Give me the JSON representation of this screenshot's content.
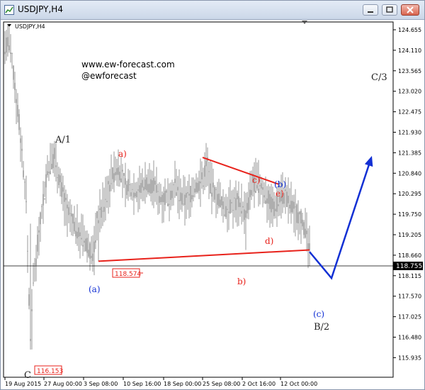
{
  "window": {
    "title": "USDJPY,H4",
    "controls": {
      "minimize": "minimize",
      "maximize": "maximize",
      "close": "close"
    }
  },
  "chart": {
    "symbol_label": "USDJPY,H4",
    "watermark": {
      "site": "www.ew-forecast.com",
      "handle": "@ewforecast"
    },
    "current_price": "118.755",
    "price_tags": {
      "low_a": "118.574",
      "low_c": "116.153"
    },
    "wave_labels": {
      "C": "C",
      "A1": "A/1",
      "a_red": "a)",
      "b_red": "b)",
      "c_red": "c)",
      "d_red": "d)",
      "e_red": "e)",
      "a_blue": "(a)",
      "b_blue": "(b)",
      "c_blue": "(c)",
      "B2": "B/2",
      "C3": "C/3"
    },
    "colors": {
      "candles": "#9a9a9a",
      "red": "#e8221b",
      "blue": "#1230d4",
      "grid": "#000000"
    }
  },
  "chart_data": {
    "type": "line",
    "y_ticks": [
      "124.655",
      "124.110",
      "123.565",
      "123.020",
      "122.475",
      "121.930",
      "121.385",
      "120.840",
      "120.295",
      "119.750",
      "119.205",
      "118.660",
      "118.115",
      "117.570",
      "117.025",
      "116.480",
      "115.935"
    ],
    "x_ticks": [
      "19 Aug 2015",
      "27 Aug 00:00",
      "3 Sep 08:00",
      "10 Sep 16:00",
      "18 Sep 00:00",
      "25 Sep 08:00",
      "2 Oct 16:00",
      "12 Oct 00:00"
    ],
    "ylim": [
      115.9,
      124.8
    ],
    "series": [
      {
        "x": [
          0,
          5,
          10,
          20,
          30,
          36,
          40,
          50,
          60,
          70,
          80,
          90,
          100,
          110,
          120,
          125,
          130,
          140,
          150,
          160,
          170,
          180,
          190,
          200,
          210,
          220,
          230,
          240,
          250,
          260,
          270,
          280,
          285,
          290,
          300,
          310,
          320,
          330,
          340,
          350,
          360,
          370,
          380,
          390,
          395,
          400,
          410,
          420,
          425,
          430
        ],
        "close": [
          124.2,
          124.35,
          123.8,
          122.2,
          120.1,
          116.2,
          118.0,
          119.6,
          120.9,
          121.3,
          120.4,
          119.7,
          119.4,
          119.1,
          118.8,
          118.6,
          119.6,
          120.0,
          120.7,
          121.0,
          120.5,
          120.4,
          120.4,
          120.6,
          120.5,
          120.2,
          120.2,
          120.5,
          120.1,
          120.2,
          120.5,
          120.7,
          121.2,
          120.5,
          120.2,
          119.9,
          120.0,
          120.1,
          119.7,
          120.6,
          120.5,
          120.2,
          119.9,
          120.3,
          120.2,
          120.1,
          119.8,
          119.6,
          119.2,
          118.75
        ]
      }
    ],
    "projection": {
      "x": [
        430,
        461,
        518
      ],
      "y": [
        118.75,
        118.05,
        121.3
      ]
    },
    "trendlines": [
      {
        "x": [
          132,
          430
        ],
        "y": [
          118.5,
          118.8
        ]
      },
      {
        "x": [
          279,
          386
        ],
        "y": [
          121.26,
          120.55
        ]
      }
    ]
  }
}
